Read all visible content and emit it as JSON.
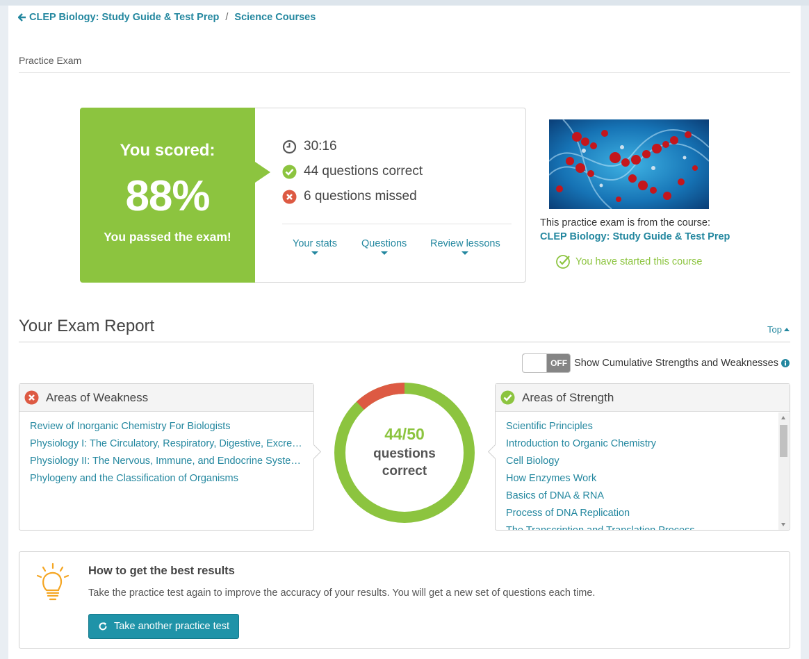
{
  "breadcrumb": {
    "course": "CLEP Biology: Study Guide & Test Prep",
    "separator": "/",
    "category": "Science Courses"
  },
  "page_label": "Practice Exam",
  "score": {
    "heading": "You scored:",
    "percent": "88%",
    "result": "You passed the exam!",
    "time": "30:16",
    "correct": "44 questions correct",
    "missed": "6 questions missed",
    "links": {
      "stats": "Your stats",
      "questions": "Questions",
      "review": "Review lessons"
    }
  },
  "course": {
    "from_text": "This practice exam is from the course:",
    "name": "CLEP Biology: Study Guide & Test Prep",
    "status": "You have started this course"
  },
  "report": {
    "title": "Your Exam Report",
    "top_link": "Top",
    "toggle_state": "OFF",
    "toggle_label": "Show Cumulative Strengths and Weaknesses",
    "weakness": {
      "title": "Areas of Weakness",
      "items": [
        "Review of Inorganic Chemistry For Biologists",
        "Physiology I: The Circulatory, Respiratory, Digestive, Excret…",
        "Physiology II: The Nervous, Immune, and Endocrine Systems",
        "Phylogeny and the Classification of Organisms"
      ]
    },
    "strength": {
      "title": "Areas of Strength",
      "items": [
        "Scientific Principles",
        "Introduction to Organic Chemistry",
        "Cell Biology",
        "How Enzymes Work",
        "Basics of DNA & RNA",
        "Process of DNA Replication",
        "The Transcription and Translation Process"
      ]
    },
    "donut": {
      "score": "44/50",
      "label_line1": "questions",
      "label_line2": "correct",
      "correct": 44,
      "total": 50
    }
  },
  "tips": {
    "title": "How to get the best results",
    "text": "Take the practice test again to improve the accuracy of your results. You will get a new set of questions each time.",
    "button": "Take another practice test"
  },
  "colors": {
    "accent": "#23879f",
    "success": "#8cc43f",
    "danger": "#dd5a43",
    "button": "#1f93a8"
  }
}
